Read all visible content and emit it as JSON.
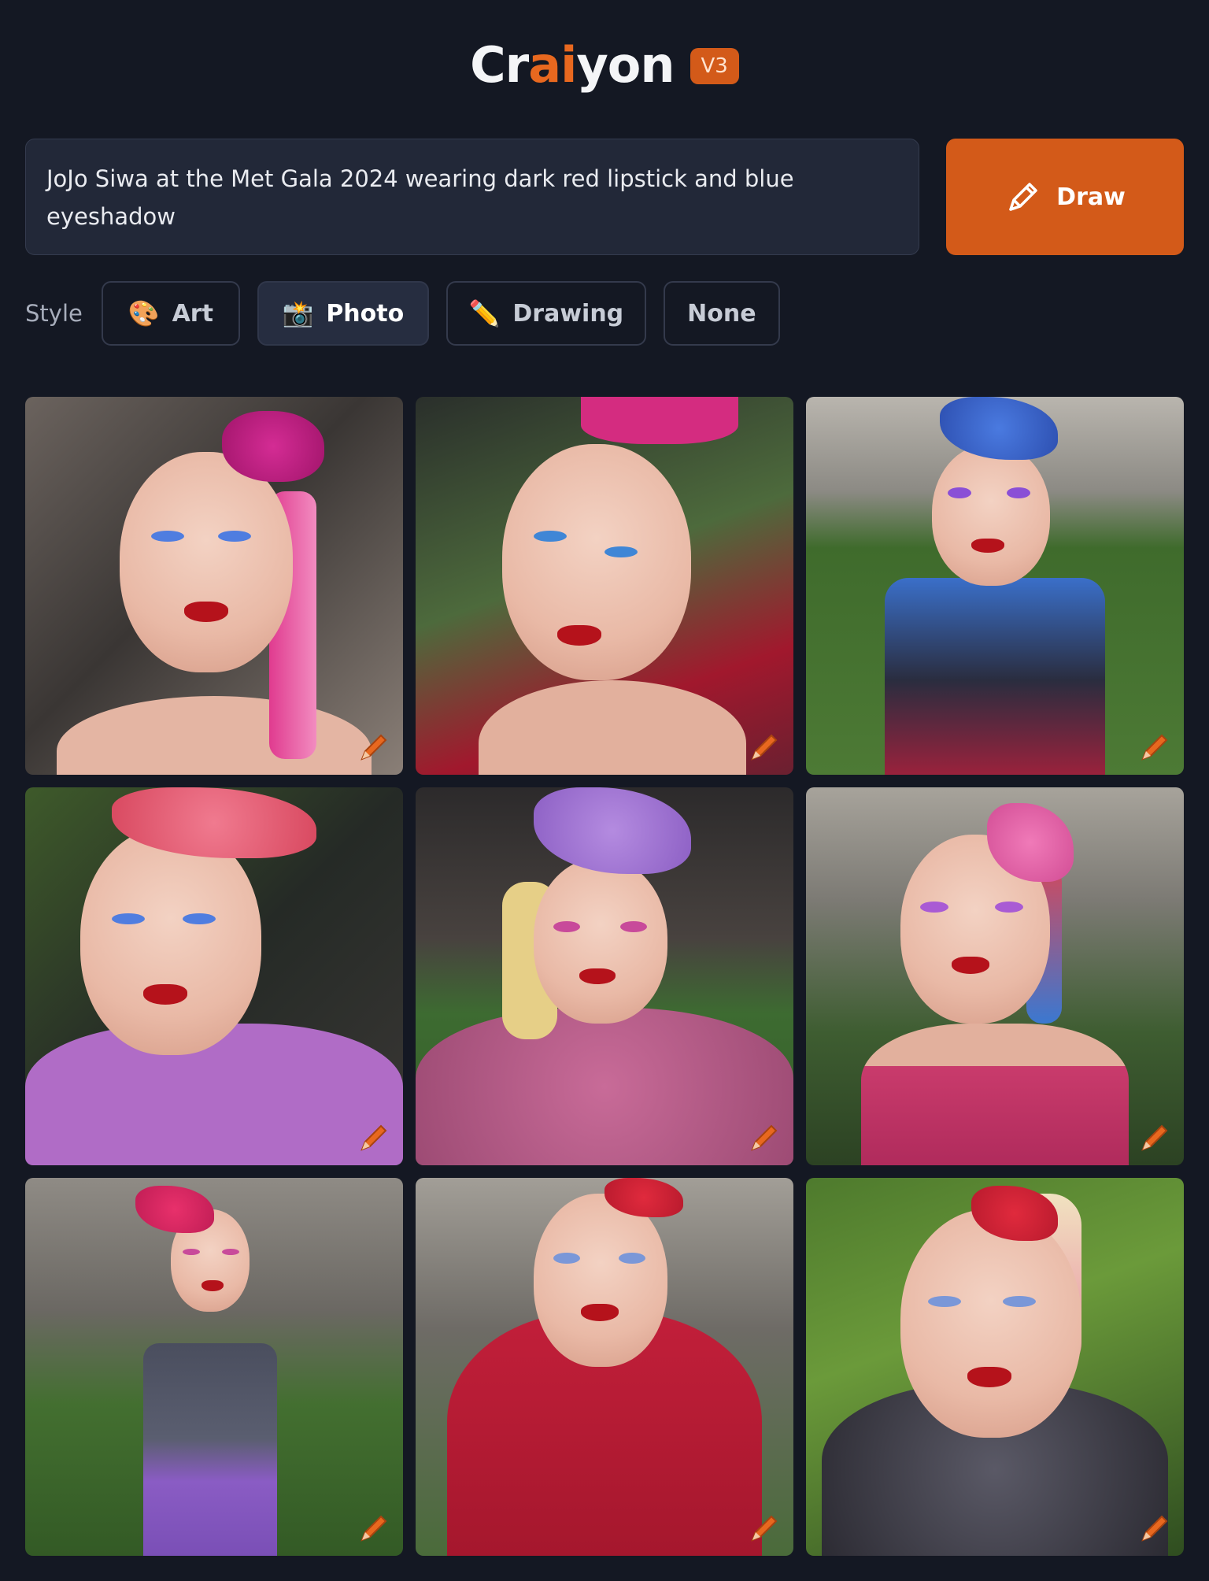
{
  "header": {
    "logo_part1": "Cr",
    "logo_part2": "ai",
    "logo_part3": "yon",
    "version": "V3"
  },
  "prompt": {
    "text": "JoJo Siwa at the Met Gala 2024 wearing dark red lipstick and blue eyeshadow"
  },
  "draw_button": {
    "label": "Draw",
    "icon": "pencil-icon"
  },
  "style": {
    "label": "Style",
    "options": [
      {
        "label": "Art",
        "emoji": "🎨",
        "icon": "palette-icon",
        "active": false
      },
      {
        "label": "Photo",
        "emoji": "📸",
        "icon": "camera-icon",
        "active": true
      },
      {
        "label": "Drawing",
        "emoji": "✏️",
        "icon": "pencil-icon",
        "active": false
      },
      {
        "label": "None",
        "emoji": "",
        "icon": "",
        "active": false
      }
    ]
  },
  "results": {
    "count": 9,
    "edit_icon": "edit-pencil-icon",
    "colors": {
      "accent": "#d35a19",
      "background": "#141823",
      "input_bg": "#222838"
    }
  }
}
